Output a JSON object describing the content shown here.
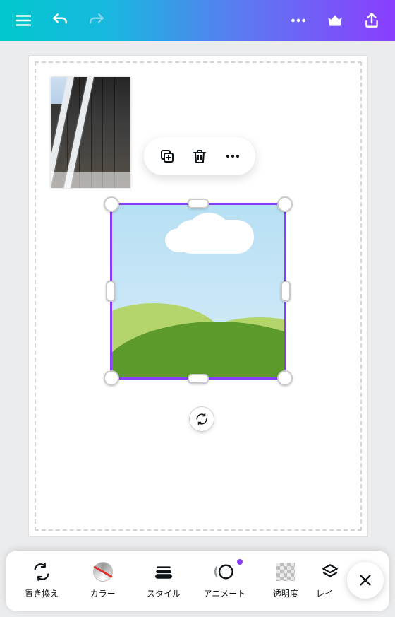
{
  "topbar": {
    "menu": "menu",
    "undo": "undo",
    "redo": "redo",
    "more": "more",
    "premium": "premium",
    "share": "share"
  },
  "context_toolbar": {
    "duplicate": "duplicate",
    "delete": "delete",
    "more": "more"
  },
  "rotate": {
    "label": "rotate"
  },
  "bottom": {
    "items": [
      {
        "id": "replace",
        "label": "置き換え"
      },
      {
        "id": "color",
        "label": "カラー"
      },
      {
        "id": "style",
        "label": "スタイル"
      },
      {
        "id": "animate",
        "label": "アニメート",
        "indicator": true
      },
      {
        "id": "transparency",
        "label": "透明度"
      },
      {
        "id": "layer",
        "label": "レイヤー"
      }
    ],
    "close": "close"
  },
  "colors": {
    "accent": "#8b3dff"
  }
}
